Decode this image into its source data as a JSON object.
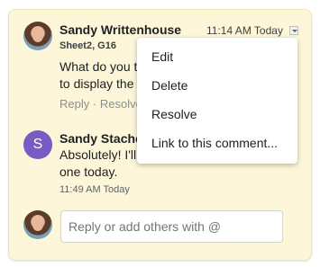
{
  "comment1": {
    "author": "Sandy Writtenhouse",
    "timestamp": "11:14 AM Today",
    "location": "Sheet2, G16",
    "text_line1": "What do you t",
    "text_line2": "to display the",
    "reply_label": "Reply",
    "separator": "·",
    "resolve_label": "Resolve"
  },
  "menu": {
    "icon": "chevron-down-icon",
    "items": [
      "Edit",
      "Delete",
      "Resolve",
      "Link to this comment..."
    ]
  },
  "comment2": {
    "avatar_letter": "S",
    "avatar_color": "#7a5bc4",
    "author": "Sandy Stache",
    "text_line1": "Absolutely! I'll",
    "text_line2": "one today.",
    "timestamp": "11:49 AM Today"
  },
  "reply_box": {
    "placeholder": "Reply or add others with @"
  }
}
